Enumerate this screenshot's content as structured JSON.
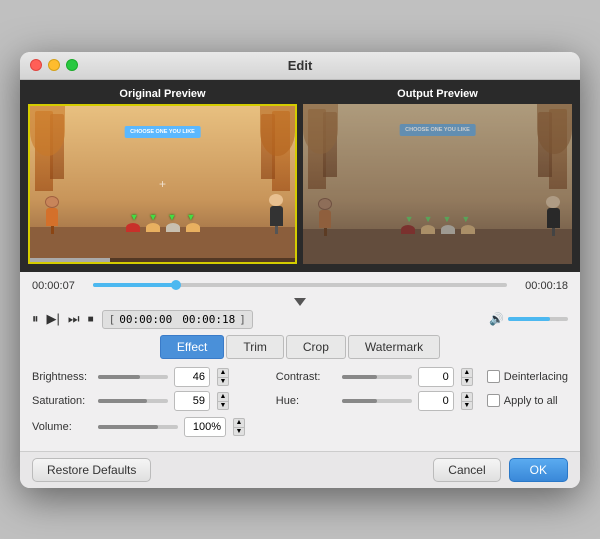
{
  "window": {
    "title": "Edit"
  },
  "previews": {
    "original_label": "Original Preview",
    "output_label": "Output Preview"
  },
  "timeline": {
    "start_time": "00:00:07",
    "end_time": "00:00:18",
    "thumb_pct": 20
  },
  "transport": {
    "timecode_start": "00:00:00",
    "timecode_end": "00:00:18"
  },
  "tabs": [
    {
      "id": "effect",
      "label": "Effect",
      "active": true
    },
    {
      "id": "trim",
      "label": "Trim",
      "active": false
    },
    {
      "id": "crop",
      "label": "Crop",
      "active": false
    },
    {
      "id": "watermark",
      "label": "Watermark",
      "active": false
    }
  ],
  "params": {
    "brightness_label": "Brightness:",
    "brightness_value": "46",
    "brightness_pct": 60,
    "contrast_label": "Contrast:",
    "contrast_value": "0",
    "contrast_pct": 50,
    "saturation_label": "Saturation:",
    "saturation_value": "59",
    "saturation_pct": 70,
    "hue_label": "Hue:",
    "hue_value": "0",
    "hue_pct": 50,
    "volume_label": "Volume:",
    "volume_value": "100%",
    "deinterlacing_label": "Deinterlacing",
    "apply_all_label": "Apply to all"
  },
  "buttons": {
    "restore_defaults": "Restore Defaults",
    "cancel": "Cancel",
    "ok": "OK"
  },
  "banner_text": "CHOOSE ONE YOU LIKE"
}
